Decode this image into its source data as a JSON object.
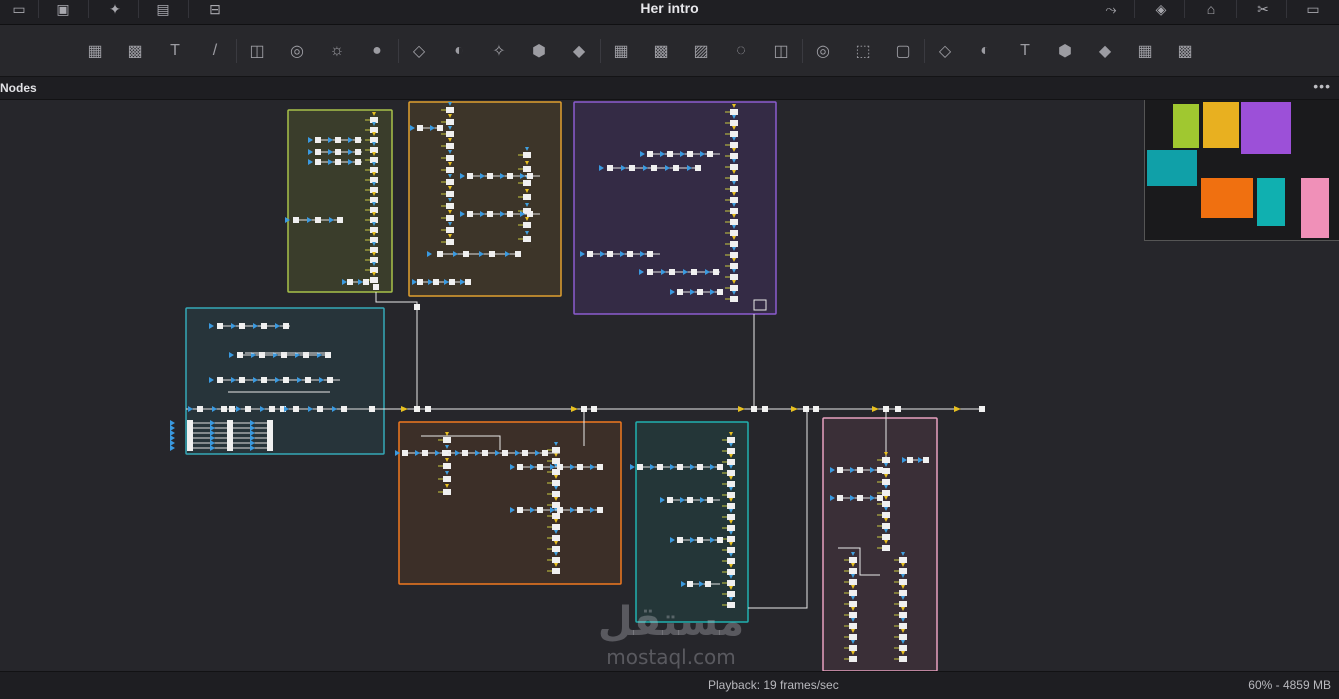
{
  "window": {
    "title": "Her intro"
  },
  "topbar": {
    "left_icons": [
      "layout-icon",
      "image-icon",
      "magic-wand-icon",
      "media-pool-icon",
      "node-graph-icon"
    ],
    "right_icons": [
      "spline-icon",
      "keyframes-icon",
      "tag-icon",
      "tools-icon",
      "monitor-icon"
    ]
  },
  "toolbar": {
    "groups": [
      [
        "background-icon",
        "fast-noise-icon",
        "text-icon",
        "paint-icon"
      ],
      [
        "blur-icon",
        "color-curves-icon",
        "brightness-icon",
        "color-corrector-icon"
      ],
      [
        "merge-icon",
        "transform-icon",
        "loader-icon",
        "saver-icon",
        "media-in-icon"
      ],
      [
        "rectangle-mask-icon",
        "ellipse-mask-icon",
        "polygon-mask-icon",
        "bspline-mask-icon",
        "wave-icon"
      ],
      [
        "particle-emitter-icon",
        "particle-render-icon",
        "particle-style-icon"
      ],
      [
        "shape-3d-icon",
        "merge-3d-icon",
        "text-3d-icon",
        "camera-3d-icon",
        "renderer-3d-icon",
        "light-3d-icon",
        "image-plane-3d-icon"
      ]
    ],
    "glyphs": {
      "text-icon": "T",
      "text-3d-icon": "T",
      "brightness-icon": "☼",
      "color-corrector-icon": "●",
      "paint-icon": "/"
    }
  },
  "panel": {
    "label": "Nodes",
    "more_label": "•••"
  },
  "node_groups": [
    {
      "name": "olive",
      "color": "#a8c24a",
      "fill": "#3a3d2b"
    },
    {
      "name": "amber",
      "color": "#e0a030",
      "fill": "#3d3529"
    },
    {
      "name": "violet",
      "color": "#8c5cd0",
      "fill": "#342b45"
    },
    {
      "name": "teal",
      "color": "#35a8b8",
      "fill": "#27343a"
    },
    {
      "name": "orange",
      "color": "#f07820",
      "fill": "#3c2f28"
    },
    {
      "name": "cyan",
      "color": "#20b0b0",
      "fill": "#243638"
    },
    {
      "name": "pink",
      "color": "#e8a0c0",
      "fill": "#3a2f37"
    }
  ],
  "navigator": {
    "swatches": [
      "#a0c830",
      "#e8b020",
      "#9c50d8",
      "#10a0a8",
      "#f07010",
      "#10b0b0",
      "#f090b8"
    ]
  },
  "status": {
    "playback": "Playback: 19 frames/sec",
    "memory": "60% - 4859 MB"
  },
  "watermark": {
    "arabic": "مستقل",
    "latin": "mostaql.com"
  }
}
